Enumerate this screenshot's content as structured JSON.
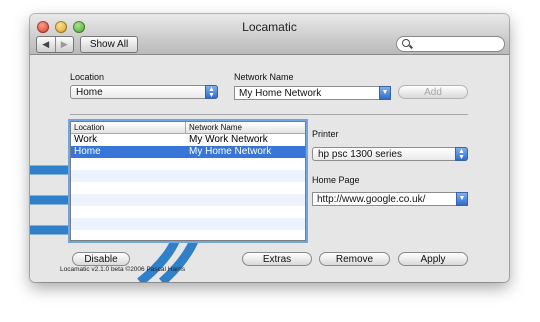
{
  "window": {
    "title": "Locamatic",
    "toolbar": {
      "back_label": "◀",
      "forward_label": "▶",
      "show_all_label": "Show All",
      "search_placeholder": ""
    }
  },
  "form": {
    "location_label": "Location",
    "location_value": "Home",
    "network_name_label": "Network Name",
    "network_name_value": "My Home Network",
    "add_label": "Add",
    "printer_label": "Printer",
    "printer_value": "hp psc 1300 series",
    "home_page_label": "Home Page",
    "home_page_value": "http://www.google.co.uk/"
  },
  "table": {
    "columns": [
      "Location",
      "Network Name"
    ],
    "rows": [
      {
        "location": "Work",
        "network": "My Work Network",
        "selected": false
      },
      {
        "location": "Home",
        "network": "My Home Network",
        "selected": true
      }
    ],
    "empty_rows": 7
  },
  "footer": {
    "disable_label": "Disable",
    "extras_label": "Extras",
    "remove_label": "Remove",
    "apply_label": "Apply",
    "version_text": "Locamatic v2.1.0 beta ©2006 Pascal Harris"
  },
  "colors": {
    "selection": "#3875d7",
    "stripe": "#edf3fe",
    "deco_blue": "#2f7fc9"
  }
}
